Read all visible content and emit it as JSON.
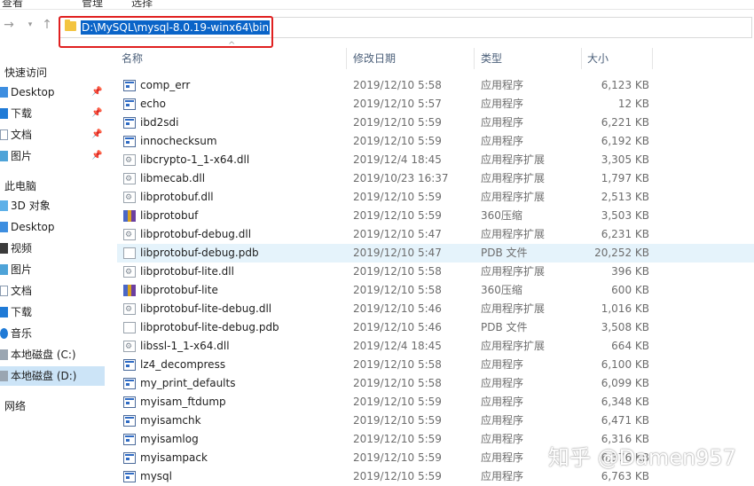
{
  "ribbon": {
    "fragments": [
      "查看",
      "管理",
      "选择"
    ]
  },
  "nav": {
    "back_icon": "arrow-left-icon",
    "forward_icon": "arrow-right-icon",
    "recent_icon": "chevron-down-icon",
    "up_icon": "arrow-up-icon"
  },
  "address": {
    "path": "D:\\MySQL\\mysql-8.0.19-winx64\\bin"
  },
  "sidebar": {
    "quick_access": "快速访问",
    "quick_items": [
      {
        "label": "Desktop"
      },
      {
        "label": "下载"
      },
      {
        "label": "文档"
      },
      {
        "label": "图片"
      }
    ],
    "this_pc": "此电脑",
    "pc_items": [
      {
        "label": "3D 对象"
      },
      {
        "label": "Desktop"
      },
      {
        "label": "视频"
      },
      {
        "label": "图片"
      },
      {
        "label": "文档"
      },
      {
        "label": "下载"
      },
      {
        "label": "音乐"
      },
      {
        "label": "本地磁盘 (C:)"
      },
      {
        "label": "本地磁盘 (D:)"
      }
    ],
    "network": "网络"
  },
  "columns": {
    "name": "名称",
    "date": "修改日期",
    "type": "类型",
    "size": "大小"
  },
  "files": [
    {
      "name": "comp_err",
      "date": "2019/12/10 5:58",
      "type": "应用程序",
      "size": "6,123 KB",
      "icon": "exe"
    },
    {
      "name": "echo",
      "date": "2019/12/10 5:57",
      "type": "应用程序",
      "size": "12 KB",
      "icon": "exe"
    },
    {
      "name": "ibd2sdi",
      "date": "2019/12/10 5:59",
      "type": "应用程序",
      "size": "6,221 KB",
      "icon": "exe"
    },
    {
      "name": "innochecksum",
      "date": "2019/12/10 5:59",
      "type": "应用程序",
      "size": "6,192 KB",
      "icon": "exe"
    },
    {
      "name": "libcrypto-1_1-x64.dll",
      "date": "2019/12/4 18:45",
      "type": "应用程序扩展",
      "size": "3,305 KB",
      "icon": "dll"
    },
    {
      "name": "libmecab.dll",
      "date": "2019/10/23 16:37",
      "type": "应用程序扩展",
      "size": "1,797 KB",
      "icon": "dll"
    },
    {
      "name": "libprotobuf.dll",
      "date": "2019/12/10 5:59",
      "type": "应用程序扩展",
      "size": "2,513 KB",
      "icon": "dll"
    },
    {
      "name": "libprotobuf",
      "date": "2019/12/10 5:59",
      "type": "360压缩",
      "size": "3,503 KB",
      "icon": "zip"
    },
    {
      "name": "libprotobuf-debug.dll",
      "date": "2019/12/10 5:47",
      "type": "应用程序扩展",
      "size": "6,231 KB",
      "icon": "dll"
    },
    {
      "name": "libprotobuf-debug.pdb",
      "date": "2019/12/10 5:47",
      "type": "PDB 文件",
      "size": "20,252 KB",
      "icon": "pdb"
    },
    {
      "name": "libprotobuf-lite.dll",
      "date": "2019/12/10 5:58",
      "type": "应用程序扩展",
      "size": "396 KB",
      "icon": "dll"
    },
    {
      "name": "libprotobuf-lite",
      "date": "2019/12/10 5:58",
      "type": "360压缩",
      "size": "600 KB",
      "icon": "zip"
    },
    {
      "name": "libprotobuf-lite-debug.dll",
      "date": "2019/12/10 5:46",
      "type": "应用程序扩展",
      "size": "1,016 KB",
      "icon": "dll"
    },
    {
      "name": "libprotobuf-lite-debug.pdb",
      "date": "2019/12/10 5:46",
      "type": "PDB 文件",
      "size": "3,508 KB",
      "icon": "pdb"
    },
    {
      "name": "libssl-1_1-x64.dll",
      "date": "2019/12/4 18:45",
      "type": "应用程序扩展",
      "size": "664 KB",
      "icon": "dll"
    },
    {
      "name": "lz4_decompress",
      "date": "2019/12/10 5:58",
      "type": "应用程序",
      "size": "6,100 KB",
      "icon": "exe"
    },
    {
      "name": "my_print_defaults",
      "date": "2019/12/10 5:58",
      "type": "应用程序",
      "size": "6,099 KB",
      "icon": "exe"
    },
    {
      "name": "myisam_ftdump",
      "date": "2019/12/10 5:59",
      "type": "应用程序",
      "size": "6,348 KB",
      "icon": "exe"
    },
    {
      "name": "myisamchk",
      "date": "2019/12/10 5:59",
      "type": "应用程序",
      "size": "6,471 KB",
      "icon": "exe"
    },
    {
      "name": "myisamlog",
      "date": "2019/12/10 5:59",
      "type": "应用程序",
      "size": "6,316 KB",
      "icon": "exe"
    },
    {
      "name": "myisampack",
      "date": "2019/12/10 5:59",
      "type": "应用程序",
      "size": "6,376 KB",
      "icon": "exe"
    },
    {
      "name": "mysql",
      "date": "2019/12/10 5:59",
      "type": "应用程序",
      "size": "6,763 KB",
      "icon": "exe"
    }
  ],
  "watermark": "知乎 @Damen957"
}
